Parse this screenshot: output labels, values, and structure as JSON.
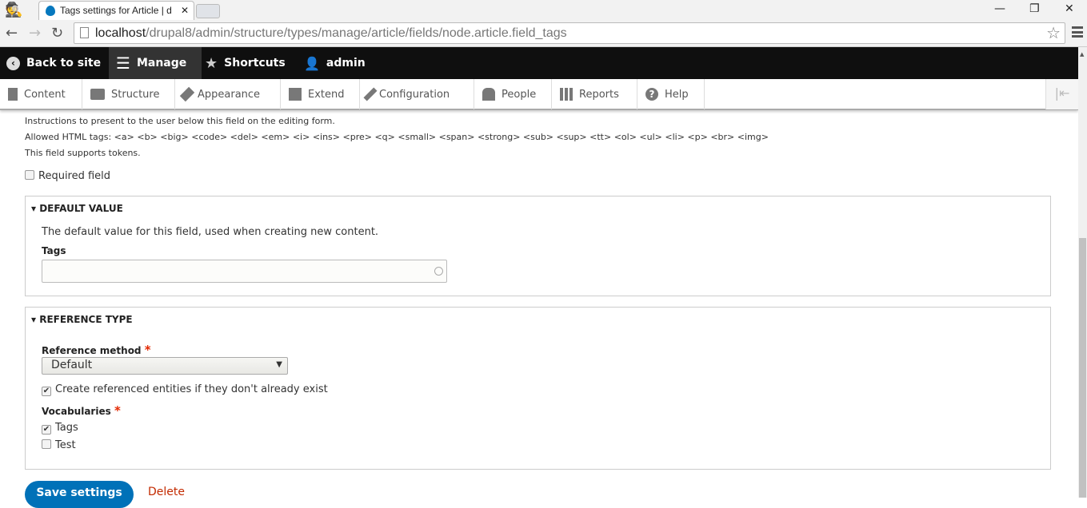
{
  "browser": {
    "tab_title": "Tags settings for Article | d",
    "url_host": "localhost",
    "url_path": "/drupal8/admin/structure/types/manage/article/fields/node.article.field_tags"
  },
  "toolbar": {
    "back": "Back to site",
    "manage": "Manage",
    "shortcuts": "Shortcuts",
    "user": "admin"
  },
  "tray": [
    {
      "label": "Content",
      "icon": "file-icon"
    },
    {
      "label": "Structure",
      "icon": "sitemap-icon"
    },
    {
      "label": "Appearance",
      "icon": "brush-icon"
    },
    {
      "label": "Extend",
      "icon": "puzzle-icon"
    },
    {
      "label": "Configuration",
      "icon": "wrench-icon"
    },
    {
      "label": "People",
      "icon": "people-icon"
    },
    {
      "label": "Reports",
      "icon": "bar-chart-icon"
    },
    {
      "label": "Help",
      "icon": "help-icon"
    }
  ],
  "help": {
    "line1": "Instructions to present to the user below this field on the editing form.",
    "line2": "Allowed HTML tags: <a> <b> <big> <code> <del> <em> <i> <ins> <pre> <q> <small> <span> <strong> <sub> <sup> <tt> <ol> <ul> <li> <p> <br> <img>",
    "line3": "This field supports tokens."
  },
  "required_label": "Required field",
  "default_value": {
    "legend": "DEFAULT VALUE",
    "description": "The default value for this field, used when creating new content.",
    "tags_label": "Tags",
    "tags_value": ""
  },
  "reference_type": {
    "legend": "REFERENCE TYPE",
    "method_label": "Reference method",
    "method_value": "Default",
    "auto_create_label": "Create referenced entities if they don't already exist",
    "vocab_label": "Vocabularies",
    "vocabs": [
      {
        "label": "Tags",
        "checked": true
      },
      {
        "label": "Test",
        "checked": false
      }
    ]
  },
  "actions": {
    "save": "Save settings",
    "delete": "Delete"
  },
  "colors": {
    "primary": "#0071b8",
    "danger": "#c32a00",
    "required": "#e32700"
  }
}
